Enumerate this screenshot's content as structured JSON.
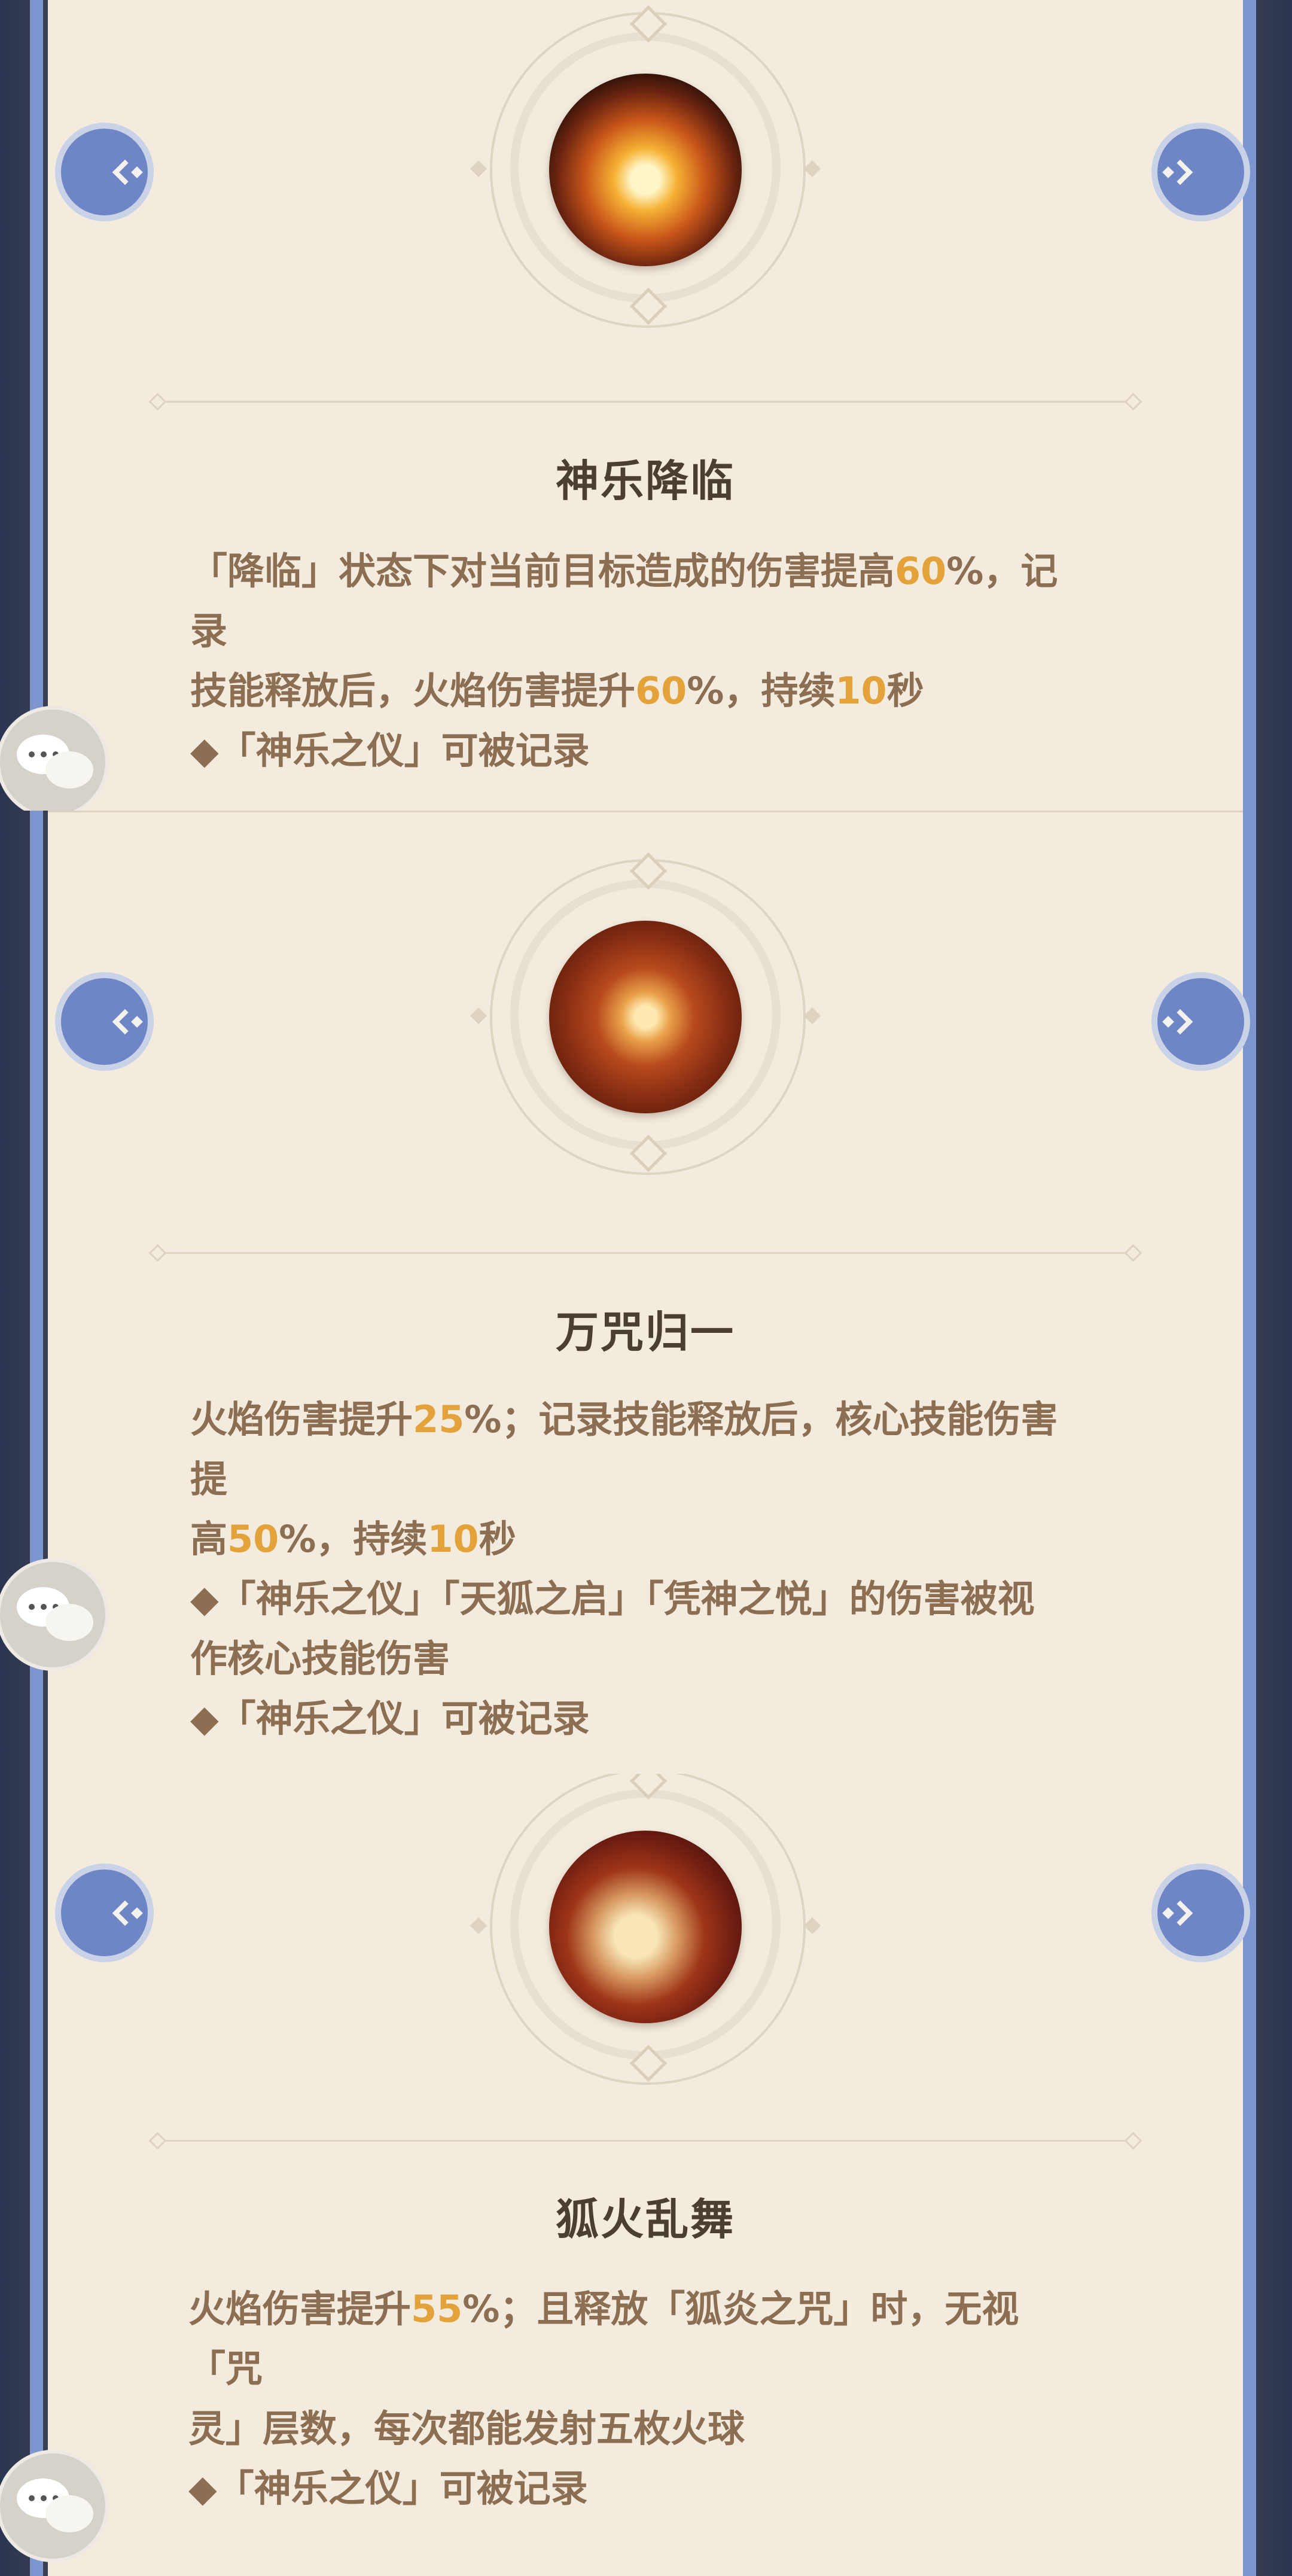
{
  "cards": [
    {
      "title": "神乐降临",
      "icon": "flame-lotus-icon",
      "icon_colors": [
        "#fff0b0",
        "#e58a20",
        "#5a1a08"
      ],
      "desc": {
        "l1a": "「降临」状态下对当前目标造成的伤害提高",
        "l1b": "60",
        "l1c": "%，记录",
        "l2a": "技能释放后，火焰伤害提升",
        "l2b": "60",
        "l2c": "%，持续",
        "l2d": "10",
        "l2e": "秒",
        "n1": "◆「神乐之仪」可被记录"
      }
    },
    {
      "title": "万咒归一",
      "icon": "fire-swirl-icon",
      "icon_colors": [
        "#ffe6a8",
        "#c85a1e",
        "#6a2210"
      ],
      "desc": {
        "l1a": "火焰伤害提升",
        "l1b": "25",
        "l1c": "%；记录技能释放后，核心技能伤害提",
        "l2a": "高",
        "l2b": "50",
        "l2c": "%，持续",
        "l2d": "10",
        "l2e": "秒",
        "n1": "◆「神乐之仪」「天狐之启」「凭神之悦」的伤害被视",
        "n1b": "作核心技能伤害",
        "n2": "◆「神乐之仪」可被记录"
      }
    },
    {
      "title": "狐火乱舞",
      "icon": "fox-fire-icon",
      "icon_colors": [
        "#f6e2b0",
        "#a63a1c",
        "#5a1810"
      ],
      "desc": {
        "l1a": "火焰伤害提升",
        "l1b": "55",
        "l1c": "%；且释放「狐炎之咒」时，无视「咒",
        "l2a": "灵」层数，每次都能发射五枚火球",
        "n1": "◆「神乐之仪」可被记录"
      }
    }
  ],
  "colors": {
    "highlight": "#e3a23a",
    "text": "#8c6e52",
    "title": "#4b3e33",
    "card": "#f3ecde",
    "nav_button": "#6e86c5"
  }
}
